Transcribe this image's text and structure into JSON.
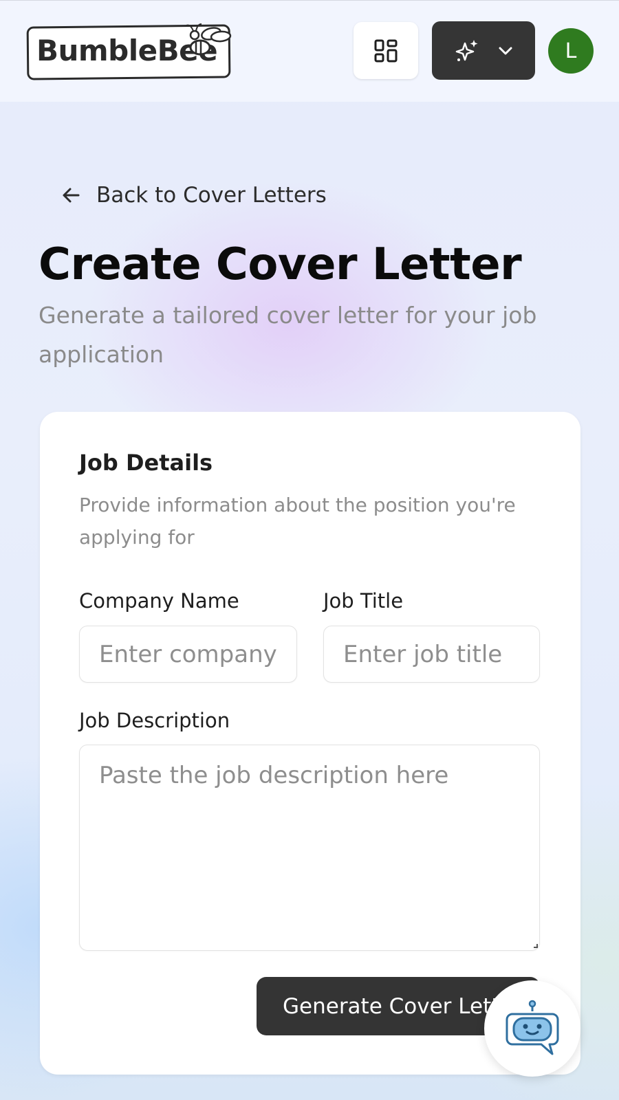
{
  "header": {
    "logo_text": "BumbleBee",
    "apps_button_icon": "grid-icon",
    "ai_button_icons": [
      "sparkles-icon",
      "chevron-down-icon"
    ],
    "avatar_initial": "L",
    "avatar_color": "#2f7b1f"
  },
  "nav": {
    "back_label": "Back to Cover Letters"
  },
  "page": {
    "title": "Create Cover Letter",
    "subtitle": "Generate a tailored cover letter for your job application"
  },
  "form": {
    "section_title": "Job Details",
    "section_desc": "Provide information about the position you're applying for",
    "company_label": "Company Name",
    "company_placeholder": "Enter company name",
    "job_title_label": "Job Title",
    "job_title_placeholder": "Enter job title",
    "description_label": "Job Description",
    "description_placeholder": "Paste the job description here",
    "generate_label": "Generate Cover Letter"
  },
  "chatbot": {
    "icon": "robot-chat-icon",
    "accent": "#2f6f9f"
  }
}
